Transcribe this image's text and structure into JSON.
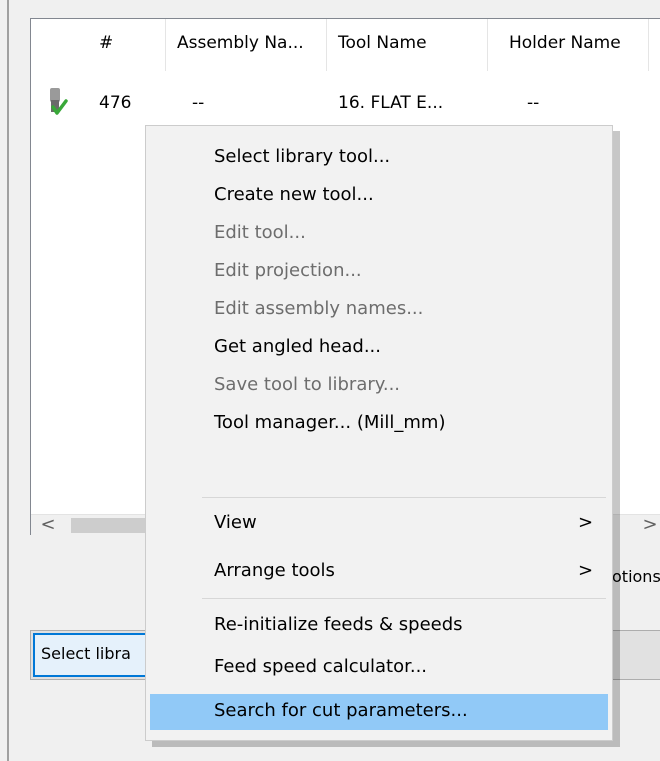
{
  "list": {
    "columns": [
      "#",
      "Assembly Na...",
      "Tool Name",
      "Holder Name"
    ],
    "rows": [
      {
        "number": "476",
        "assembly": "--",
        "tool_name": "16. FLAT E...",
        "holder": "--"
      }
    ]
  },
  "scrollbar": {
    "left_arrow": "<",
    "right_arrow": ">"
  },
  "background": {
    "options_partial": "otions",
    "select_library_partial": "Select libra"
  },
  "context_menu": {
    "items": [
      {
        "label": "Select library tool...",
        "disabled": false
      },
      {
        "label": "Create new tool...",
        "disabled": false
      },
      {
        "label": "Edit tool...",
        "disabled": true
      },
      {
        "label": "Edit projection...",
        "disabled": true
      },
      {
        "label": "Edit assembly names...",
        "disabled": true
      },
      {
        "label": "Get angled head...",
        "disabled": false
      },
      {
        "label": "Save tool to library...",
        "disabled": true
      },
      {
        "label": "Tool manager...  (Mill_mm)",
        "disabled": false
      },
      {
        "label": "View",
        "disabled": false,
        "submenu": true
      },
      {
        "label": "Arrange tools",
        "disabled": false,
        "submenu": true
      },
      {
        "label": "Re-initialize feeds & speeds",
        "disabled": false
      },
      {
        "label": "Feed speed calculator...",
        "disabled": false
      },
      {
        "label": "Search for cut parameters...",
        "disabled": false,
        "highlighted": true
      }
    ],
    "submenu_arrow": ">"
  },
  "colors": {
    "highlight": "#91c9f7",
    "disabled_text": "#6d6d6d",
    "focus_border": "#0078d7"
  }
}
